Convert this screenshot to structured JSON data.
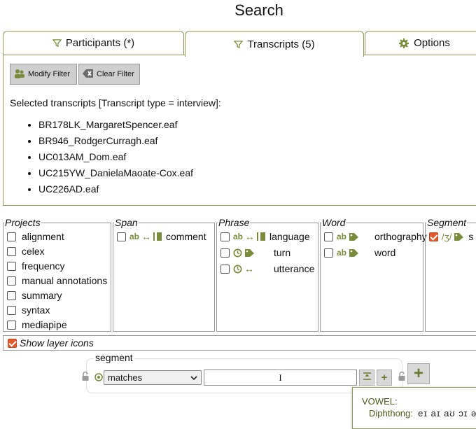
{
  "page": {
    "title": "Search"
  },
  "tabs": [
    {
      "label": "Participants (*)",
      "icon": "filter-icon"
    },
    {
      "label": "Transcripts (5)",
      "icon": "filter-icon",
      "active": true
    },
    {
      "label": "Options",
      "icon": "gear-icon"
    }
  ],
  "transcripts_panel": {
    "modify_filter": "Modify Filter",
    "clear_filter": "Clear Filter",
    "selected_label": "Selected transcripts [Transcript type = interview]:",
    "items": [
      "BR178LK_MargaretSpencer.eaf",
      "BR946_RodgerCurragh.eaf",
      "UC013AM_Dom.eaf",
      "UC215YW_DanielaMaoate-Cox.eaf",
      "UC226AD.eaf"
    ]
  },
  "layers": {
    "projects": {
      "legend": "Projects",
      "items": [
        "alignment",
        "celex",
        "frequency",
        "manual annotations",
        "summary",
        "syntax",
        "mediapipe"
      ]
    },
    "span": {
      "legend": "Span",
      "items": [
        {
          "label": "comment",
          "icons": "ab ↔ ▮"
        }
      ]
    },
    "phrase": {
      "legend": "Phrase",
      "items": [
        {
          "label": "language",
          "icons": "ab ↔ ▮"
        },
        {
          "label": "turn",
          "icons": "clock tag"
        },
        {
          "label": "utterance",
          "icons": "clock ↔"
        }
      ]
    },
    "word": {
      "legend": "Word",
      "items": [
        {
          "label": "orthography",
          "icons": "ab tag"
        },
        {
          "label": "word",
          "icons": "ab tag"
        }
      ]
    },
    "segment": {
      "legend": "Segment",
      "items": [
        {
          "label": "s",
          "icons": "/3/ tag",
          "checked": true
        }
      ]
    },
    "show_icons": {
      "label": "Show layer icons",
      "checked": true
    }
  },
  "matrix": {
    "layer_label": "segment",
    "match_select": "matches",
    "pattern_value": "I",
    "add_label": "+"
  },
  "popup": {
    "heading": "VOWEL",
    "row_label": "Diphthong",
    "row_value": "eɪ aɪ aʊ ɔɪ ə"
  },
  "colors": {
    "accent": "#7a8c3c",
    "border": "#8a9a5b",
    "checked": "#e05a2b"
  }
}
